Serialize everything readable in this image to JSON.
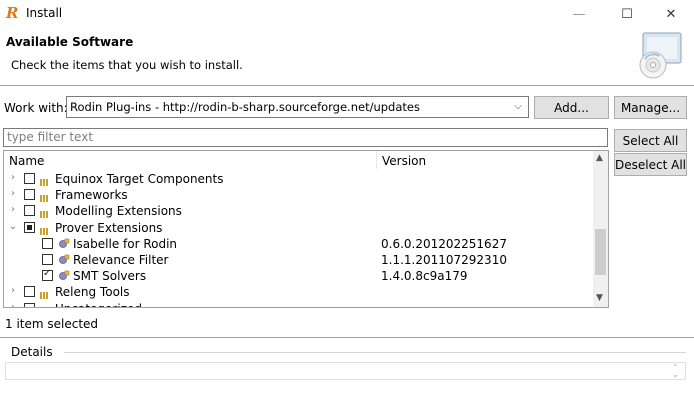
{
  "window": {
    "title": "Install",
    "minimize_glyph": "—",
    "maximize_glyph": "☐",
    "close_glyph": "✕"
  },
  "banner": {
    "title": "Available Software",
    "subtitle": "Check the items that you wish to install.",
    "image_icon": "install-wizard-icon"
  },
  "work_with": {
    "label": "Work with:",
    "value": "Rodin Plug-ins - http://rodin-b-sharp.sourceforge.net/updates",
    "add_label": "Add...",
    "manage_label": "Manage..."
  },
  "filter": {
    "placeholder": "type filter text",
    "select_all_label": "Select All",
    "deselect_all_label": "Deselect All"
  },
  "tree": {
    "columns": {
      "name": "Name",
      "version": "Version"
    },
    "rows": [
      {
        "label": "Equinox Target Components",
        "version": "",
        "level": 0,
        "expanded": false,
        "state": "unchecked"
      },
      {
        "label": "Frameworks",
        "version": "",
        "level": 0,
        "expanded": false,
        "state": "unchecked"
      },
      {
        "label": "Modelling Extensions",
        "version": "",
        "level": 0,
        "expanded": false,
        "state": "unchecked"
      },
      {
        "label": "Prover Extensions",
        "version": "",
        "level": 0,
        "expanded": true,
        "state": "partial"
      },
      {
        "label": "Isabelle for Rodin",
        "version": "0.6.0.201202251627",
        "level": 1,
        "state": "unchecked"
      },
      {
        "label": "Relevance Filter",
        "version": "1.1.1.201107292310",
        "level": 1,
        "state": "unchecked"
      },
      {
        "label": "SMT Solvers",
        "version": "1.4.0.8c9a179",
        "level": 1,
        "state": "checked"
      },
      {
        "label": "Releng Tools",
        "version": "",
        "level": 0,
        "expanded": false,
        "state": "unchecked"
      },
      {
        "label": "Uncategorized",
        "version": "",
        "level": 0,
        "expanded": false,
        "state": "unchecked"
      }
    ]
  },
  "status": {
    "text": "1 item selected"
  },
  "details": {
    "label": "Details"
  }
}
